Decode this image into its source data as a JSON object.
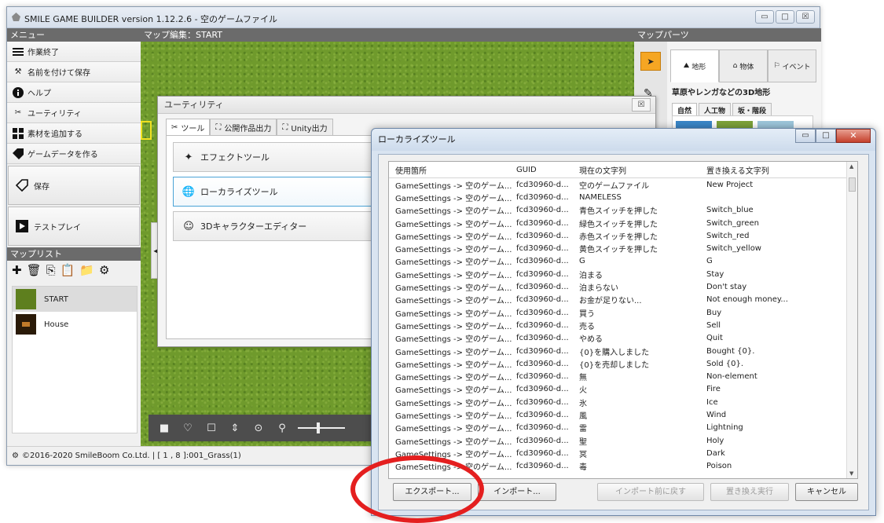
{
  "main_window": {
    "title": "SMILE GAME BUILDER version 1.12.2.6 - 空のゲームファイル",
    "min_label": "▭",
    "max_label": "□",
    "close_label": "☒"
  },
  "left_panel": {
    "header": "メニュー",
    "menu_items": [
      {
        "label": "作業終了",
        "icon": "menu-lines-icon"
      },
      {
        "label": "名前を付けて保存",
        "icon": "hammer-icon"
      },
      {
        "label": "ヘルプ",
        "icon": "info-icon"
      },
      {
        "label": "ユーティリティ",
        "icon": "tools-icon"
      },
      {
        "label": "素材を追加する",
        "icon": "grid-icon"
      },
      {
        "label": "ゲームデータを作る",
        "icon": "tag-icon"
      }
    ],
    "save_button": "保存",
    "testplay_button": "テストプレイ",
    "maplist_header": "マップリスト",
    "maps": [
      {
        "name": "START",
        "selected": true
      },
      {
        "name": "House",
        "selected": false
      }
    ]
  },
  "map_editor": {
    "header": "マップ編集：START"
  },
  "status_bar": {
    "text": "©2016-2020 SmileBoom Co.Ltd.  | [ 1 , 8 ]:001_Grass(1)"
  },
  "right_panel": {
    "header": "マップパーツ",
    "tabs": [
      "地形",
      "物体",
      "イベント"
    ],
    "description": "草原やレンガなどの3D地形",
    "subtabs": [
      "自然",
      "人工物",
      "坂・階段"
    ]
  },
  "utility_dialog": {
    "title": "ユーティリティ",
    "close_label": "☒",
    "tabs": [
      "ツール",
      "公開作品出力",
      "Unity出力"
    ],
    "buttons": [
      "エフェクトツール",
      "ローカライズツール",
      "3Dキャラクターエディター"
    ]
  },
  "localize_window": {
    "title": "ローカライズツール",
    "min_label": "▭",
    "max_label": "□",
    "close_label": "✕",
    "columns": [
      "使用箇所",
      "GUID",
      "現在の文字列",
      "置き換える文字列"
    ],
    "rows": [
      [
        "GameSettings -> 空のゲーム...",
        "fcd30960-d...",
        "空のゲームファイル",
        "New Project"
      ],
      [
        "GameSettings -> 空のゲーム...",
        "fcd30960-d...",
        "NAMELESS",
        ""
      ],
      [
        "GameSettings -> 空のゲーム...",
        "fcd30960-d...",
        "青色スイッチを押した",
        "Switch_blue"
      ],
      [
        "GameSettings -> 空のゲーム...",
        "fcd30960-d...",
        "緑色スイッチを押した",
        "Switch_green"
      ],
      [
        "GameSettings -> 空のゲーム...",
        "fcd30960-d...",
        "赤色スイッチを押した",
        "Switch_red"
      ],
      [
        "GameSettings -> 空のゲーム...",
        "fcd30960-d...",
        "黄色スイッチを押した",
        "Switch_yellow"
      ],
      [
        "GameSettings -> 空のゲーム...",
        "fcd30960-d...",
        "G",
        "G"
      ],
      [
        "GameSettings -> 空のゲーム...",
        "fcd30960-d...",
        "泊まる",
        "Stay"
      ],
      [
        "GameSettings -> 空のゲーム...",
        "fcd30960-d...",
        "泊まらない",
        "Don't stay"
      ],
      [
        "GameSettings -> 空のゲーム...",
        "fcd30960-d...",
        "お金が足りない...",
        "Not enough money..."
      ],
      [
        "GameSettings -> 空のゲーム...",
        "fcd30960-d...",
        "買う",
        "Buy"
      ],
      [
        "GameSettings -> 空のゲーム...",
        "fcd30960-d...",
        "売る",
        "Sell"
      ],
      [
        "GameSettings -> 空のゲーム...",
        "fcd30960-d...",
        "やめる",
        "Quit"
      ],
      [
        "GameSettings -> 空のゲーム...",
        "fcd30960-d...",
        "{0}を購入しました",
        "Bought {0}."
      ],
      [
        "GameSettings -> 空のゲーム...",
        "fcd30960-d...",
        "{0}を売却しました",
        "Sold {0}."
      ],
      [
        "GameSettings -> 空のゲーム...",
        "fcd30960-d...",
        "無",
        "Non-element"
      ],
      [
        "GameSettings -> 空のゲーム...",
        "fcd30960-d...",
        "火",
        "Fire"
      ],
      [
        "GameSettings -> 空のゲーム...",
        "fcd30960-d...",
        "氷",
        "Ice"
      ],
      [
        "GameSettings -> 空のゲーム...",
        "fcd30960-d...",
        "風",
        "Wind"
      ],
      [
        "GameSettings -> 空のゲーム...",
        "fcd30960-d...",
        "雷",
        "Lightning"
      ],
      [
        "GameSettings -> 空のゲーム...",
        "fcd30960-d...",
        "聖",
        "Holy"
      ],
      [
        "GameSettings -> 空のゲーム...",
        "fcd30960-d...",
        "冥",
        "Dark"
      ],
      [
        "GameSettings -> 空のゲーム...",
        "fcd30960-d...",
        "毒",
        "Poison"
      ]
    ],
    "buttons": {
      "export": "エクスポート...",
      "import": "インポート...",
      "revert": "インポート前に戻す",
      "replace": "置き換え実行",
      "cancel": "キャンセル"
    }
  },
  "colors": {
    "panel_header": "#6b6b6b",
    "accent_orange": "#f5a623",
    "highlight_circle": "#e41f1f"
  }
}
